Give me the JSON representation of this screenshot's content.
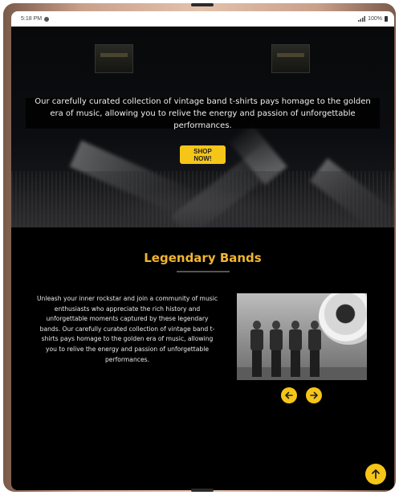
{
  "status_bar": {
    "time": "5:18 PM",
    "battery": "100%",
    "icons": [
      "notification-icon",
      "signal-icon",
      "battery-icon"
    ]
  },
  "hero": {
    "tagline": "Our carefully curated collection of vintage band t-shirts pays homage to the golden era of music, allowing you to relive the energy and passion of unforgettable performances.",
    "cta_label": "SHOP NOW!"
  },
  "section": {
    "title": "Legendary Bands",
    "body": "Unleash your inner rockstar and join a community of music enthusiasts who appreciate the rich history and unforgettable moments captured by these legendary bands. Our carefully curated collection of vintage band t-shirts pays homage to the golden era of music, allowing you to relive the energy and passion of unforgettable performances."
  },
  "carousel": {
    "prev_icon": "arrow-left-icon",
    "next_icon": "arrow-right-icon"
  },
  "scroll_top_icon": "arrow-up-icon",
  "colors": {
    "accent": "#f5c518",
    "title": "#f2b531",
    "background": "#000000"
  }
}
